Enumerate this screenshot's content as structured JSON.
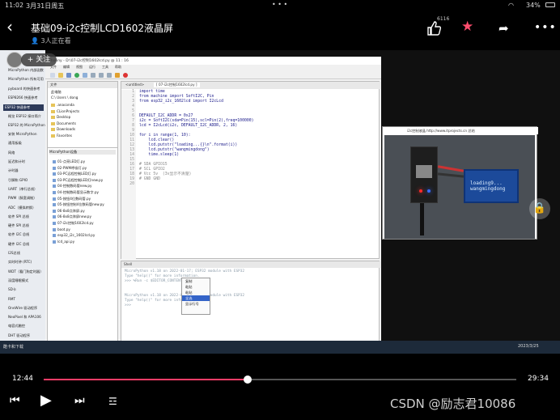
{
  "status_bar": {
    "time": "11:02",
    "date": "3月31日周五",
    "battery": "34%"
  },
  "header": {
    "title": "基础09-i2c控制LCD1602液晶屏",
    "watching": "3人正在看",
    "like_count": "6116"
  },
  "overlay": {
    "follow_label": "+ 关注"
  },
  "left_sidebar": {
    "items": [
      "MicroPython 内部函数",
      "MicroPython 所有可用",
      "pyboard 的快速参考",
      "ESP8266 快速参考",
      "ESP32 快速参考",
      "概览 ESP32 接口简介",
      "ESP32 的 MicroPython",
      "安装 MicroPython",
      "通用板级",
      "网络",
      "延迟和计时",
      "计时器",
      "引脚和 GPIO",
      "UART（串行总线）",
      "PWM（脉宽调制）",
      "ADC（模拟转换）",
      "软件 SPI 总线",
      "硬件 SPI 总线",
      "软件 I2C 总线",
      "硬件 I2C 总线",
      "I2S总线",
      "实时时钟 (RTC)",
      "WDT（看门狗定时器）",
      "深度睡眠模式",
      "SD卡",
      "RMT",
      "OneWire 驱动程序",
      "NeoPixel 和 APA106",
      "电容式触控",
      "DHT 驱动程序",
      "WebREPL（网络浏览器"
    ],
    "selected_index": 4
  },
  "ide": {
    "title": "Thonny - D:\\07-i2c控制1602lcd.py @ 11 : 16",
    "menu": [
      "文件",
      "编辑",
      "视图",
      "运行",
      "工具",
      "帮助"
    ],
    "files_header": "文件",
    "local_label": "此电脑",
    "path": "C:\\ Users \\ dong",
    "folders": [
      ".anaconda",
      "CLionProjects",
      "Desktop",
      "Documents",
      "Downloads",
      "Favorites"
    ],
    "device_header": "MicroPython设备",
    "device_files": [
      "01-点亮LED灯.py",
      "02-PWM呼吸灯.py",
      "03-PC远程控制LED灯.py",
      "03-PC远程控制LED灯new.py",
      "04-控制数码管new.py",
      "04-控制数码管显示数字.py",
      "05-按钮4位数码管.py",
      "05-按钮控制4位数码管new.py",
      "06-8x8点阵屏.py",
      "06-8x8点阵屏new.py",
      "07-i2c控制1602lcd.py",
      "boot.py",
      "esp32_i2c_1602lcd.py",
      "lcd_api.py"
    ],
    "tabs": [
      "<untitled>",
      "[ 07-i2c控制1602lcd.py ]"
    ],
    "code_lines": [
      "import time",
      "from machine import SoftI2C, Pin",
      "from esp32_i2c_1602lcd import I2cLcd",
      "",
      "",
      "DEFAULT_I2C_ADDR = 0x27",
      "i2c = SoftI2C(sda=Pin(15),scl=Pin(2),freq=100000)",
      "lcd = I2cLcd(i2c, DEFAULT_I2C_ADDR, 2, 16)",
      "",
      "for i in range(1, 10):",
      "    lcd.clear()",
      "    lcd.putstr(\"loading...{}\\n\".format(i))",
      "    lcd.putstr(\"wangmingdong\")",
      "    time.sleep(1)",
      "",
      "# SDA GPIO15",
      "# SCL GPIO2",
      "# Vcc 5v  (3v显示不清楚)",
      "# GND GND",
      ""
    ],
    "shell_header": "Shell",
    "shell_lines": [
      "MicroPython v1.18 on 2022-01-17; ESP32 module with ESP32",
      "Type \"help()\" for more information.",
      ">>> %Run -c $EDITOR_CONTENT",
      "",
      "",
      "MicroPython v1.18 on 2022-01-17; ESP32 module with ESP32",
      "Type \"help()\" for more information.",
      ">>>"
    ],
    "context_menu": [
      "复制",
      "粘贴",
      "粘贴",
      "全选",
      "显示行号"
    ],
    "status_right": "MicroPython (ESP32)"
  },
  "browser": {
    "bar_text": "i2c控制液晶 http://www.itprojects.cn 总结"
  },
  "lcd": {
    "line1": "loading9...",
    "line2": "wangmingdong"
  },
  "taskbar": {
    "left_text": "酷卡和下载",
    "clock": "2023/3/25"
  },
  "player": {
    "current": "12:44",
    "total": "29:34",
    "progress_fraction": 0.432
  },
  "watermark": "CSDN @励志君10086",
  "colors": {
    "accent": "#ff3d68",
    "fav": "#ff4d6d"
  }
}
